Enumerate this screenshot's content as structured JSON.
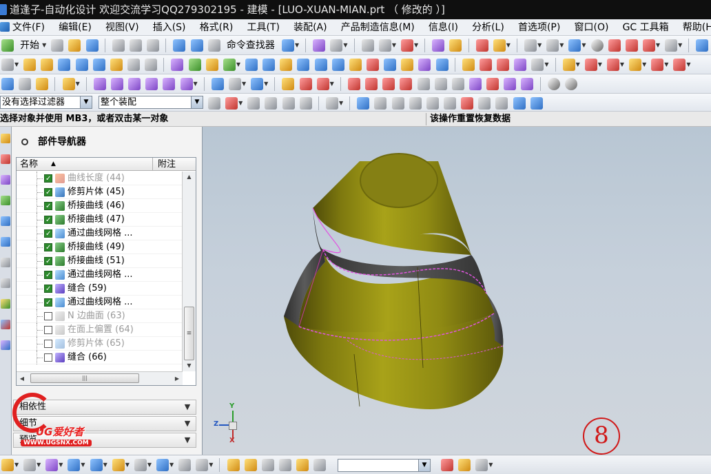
{
  "window": {
    "title": "道逢子-自动化设计 欢迎交流学习QQ279302195 - 建模 - [LUO-XUAN-MIAN.prt （ 修改的 ）]"
  },
  "menu": [
    "文件(F)",
    "编辑(E)",
    "视图(V)",
    "插入(S)",
    "格式(R)",
    "工具(T)",
    "装配(A)",
    "产品制造信息(M)",
    "信息(I)",
    "分析(L)",
    "首选项(P)",
    "窗口(O)",
    "GC 工具箱",
    "帮助(H)"
  ],
  "toolbar": {
    "start_label": "开始",
    "command_finder_label": "命令查找器"
  },
  "selection": {
    "filter_value": "没有选择过滤器",
    "scope_value": "整个装配"
  },
  "cue": {
    "prompt": "选择对象并使用 MB3，或者双击某一对象",
    "status": "该操作重置恢复数据"
  },
  "navigator": {
    "title": "部件导航器",
    "col_name": "名称",
    "col_sort_icon": "▲",
    "col_note": "附注",
    "rows": [
      {
        "label": "曲线长度 (44)",
        "checked": true,
        "icon": "curve-length-icon",
        "dim": true
      },
      {
        "label": "修剪片体 (45)",
        "checked": true,
        "icon": "trim-sheet-icon",
        "dim": false
      },
      {
        "label": "桥接曲线 (46)",
        "checked": true,
        "icon": "bridge-curve-icon",
        "dim": false
      },
      {
        "label": "桥接曲线 (47)",
        "checked": true,
        "icon": "bridge-curve-icon",
        "dim": false
      },
      {
        "label": "通过曲线网格 ...",
        "checked": true,
        "icon": "curve-mesh-icon",
        "dim": false
      },
      {
        "label": "桥接曲线 (49)",
        "checked": true,
        "icon": "bridge-curve-icon",
        "dim": false
      },
      {
        "label": "桥接曲线 (51)",
        "checked": true,
        "icon": "bridge-curve-icon",
        "dim": false
      },
      {
        "label": "通过曲线网格 ...",
        "checked": true,
        "icon": "curve-mesh-icon",
        "dim": false
      },
      {
        "label": "缝合 (59)",
        "checked": true,
        "icon": "sew-icon",
        "dim": false
      },
      {
        "label": "通过曲线网格 ...",
        "checked": true,
        "icon": "curve-mesh-icon",
        "dim": false
      },
      {
        "label": "N 边曲面 (63)",
        "checked": false,
        "icon": "n-sided-surface-icon",
        "dim": true
      },
      {
        "label": "在面上偏置 (64)",
        "checked": false,
        "icon": "offset-in-face-icon",
        "dim": true
      },
      {
        "label": "修剪片体 (65)",
        "checked": false,
        "icon": "trim-sheet-icon",
        "dim": true
      },
      {
        "label": "缝合 (66)",
        "checked": false,
        "icon": "sew-icon",
        "dim": false
      }
    ],
    "sections": [
      "相依性",
      "细节",
      "预览"
    ]
  },
  "viewport": {
    "step_marker": "8",
    "triad": {
      "x": "X",
      "y": "Y",
      "z": "Z"
    },
    "colors": {
      "body": "#8f8a13",
      "groove": "#4a4a4a",
      "edge": "#e055e0",
      "background": "#c3cdd8"
    }
  },
  "watermark": {
    "text": "UG爱好者",
    "url": "WWW.UGSNX.COM"
  }
}
